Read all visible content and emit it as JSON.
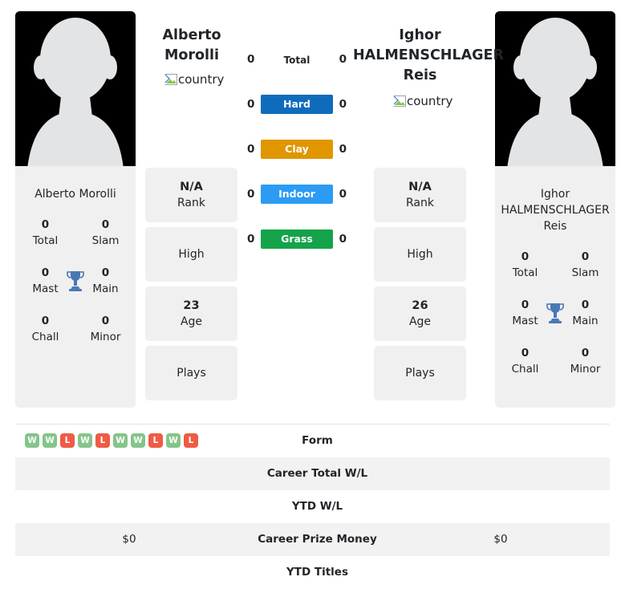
{
  "players": {
    "left": {
      "name_lines": [
        "Alberto",
        "Morolli"
      ],
      "full_name": "Alberto Morolli",
      "country_alt": "country",
      "photo_alt": "player-photo",
      "rank_value": "N/A",
      "rank_label": "Rank",
      "high_value": "",
      "high_label": "High",
      "age_value": "23",
      "age_label": "Age",
      "plays_value": "",
      "plays_label": "Plays",
      "titles": [
        {
          "num": "0",
          "label": "Total"
        },
        {
          "num": "0",
          "label": "Slam"
        },
        {
          "num": "0",
          "label": "Mast"
        },
        {
          "num": "0",
          "label": "Main"
        },
        {
          "num": "0",
          "label": "Chall"
        },
        {
          "num": "0",
          "label": "Minor"
        }
      ]
    },
    "right": {
      "name_lines": [
        "Ighor",
        "HALMENSCHLAGER",
        "Reis"
      ],
      "full_name_lines": [
        "Ighor",
        "HALMENSCHLAGER",
        "Reis"
      ],
      "country_alt": "country",
      "photo_alt": "player-photo",
      "rank_value": "N/A",
      "rank_label": "Rank",
      "high_value": "",
      "high_label": "High",
      "age_value": "26",
      "age_label": "Age",
      "plays_value": "",
      "plays_label": "Plays",
      "titles": [
        {
          "num": "0",
          "label": "Total"
        },
        {
          "num": "0",
          "label": "Slam"
        },
        {
          "num": "0",
          "label": "Mast"
        },
        {
          "num": "0",
          "label": "Main"
        },
        {
          "num": "0",
          "label": "Chall"
        },
        {
          "num": "0",
          "label": "Minor"
        }
      ]
    }
  },
  "head_to_head": [
    {
      "label": "Total",
      "left": "0",
      "right": "0",
      "color": "transparent",
      "text_color": "#212529"
    },
    {
      "label": "Hard",
      "left": "0",
      "right": "0",
      "color": "#0f6cbd",
      "text_color": "#ffffff"
    },
    {
      "label": "Clay",
      "left": "0",
      "right": "0",
      "color": "#e09600",
      "text_color": "#ffffff"
    },
    {
      "label": "Indoor",
      "left": "0",
      "right": "0",
      "color": "#2b9bf4",
      "text_color": "#ffffff"
    },
    {
      "label": "Grass",
      "left": "0",
      "right": "0",
      "color": "#14a34a",
      "text_color": "#ffffff"
    }
  ],
  "comparison_rows": [
    {
      "label": "Form",
      "left_value": "",
      "right_value": "",
      "shaded": false,
      "type": "form",
      "left_form": [
        "W",
        "W",
        "L",
        "W",
        "L",
        "W",
        "W",
        "L",
        "W",
        "L"
      ],
      "right_form": []
    },
    {
      "label": "Career Total W/L",
      "left_value": "",
      "right_value": "",
      "shaded": true,
      "type": "text"
    },
    {
      "label": "YTD W/L",
      "left_value": "",
      "right_value": "",
      "shaded": false,
      "type": "text"
    },
    {
      "label": "Career Prize Money",
      "left_value": "$0",
      "right_value": "$0",
      "shaded": true,
      "type": "text"
    },
    {
      "label": "YTD Titles",
      "left_value": "",
      "right_value": "",
      "shaded": false,
      "type": "text"
    }
  ],
  "icons": {
    "trophy": "trophy-icon",
    "broken_image": "broken-image-icon",
    "silhouette": "person-silhouette-icon"
  },
  "colors": {
    "hard": "#0f6cbd",
    "clay": "#e09600",
    "indoor": "#2b9bf4",
    "grass": "#14a34a",
    "win": "#84c58a",
    "loss": "#ef5b45",
    "trophy": "#4a77b5",
    "panel_bg": "#f0f0f0",
    "row_shade": "#f2f2f2"
  }
}
